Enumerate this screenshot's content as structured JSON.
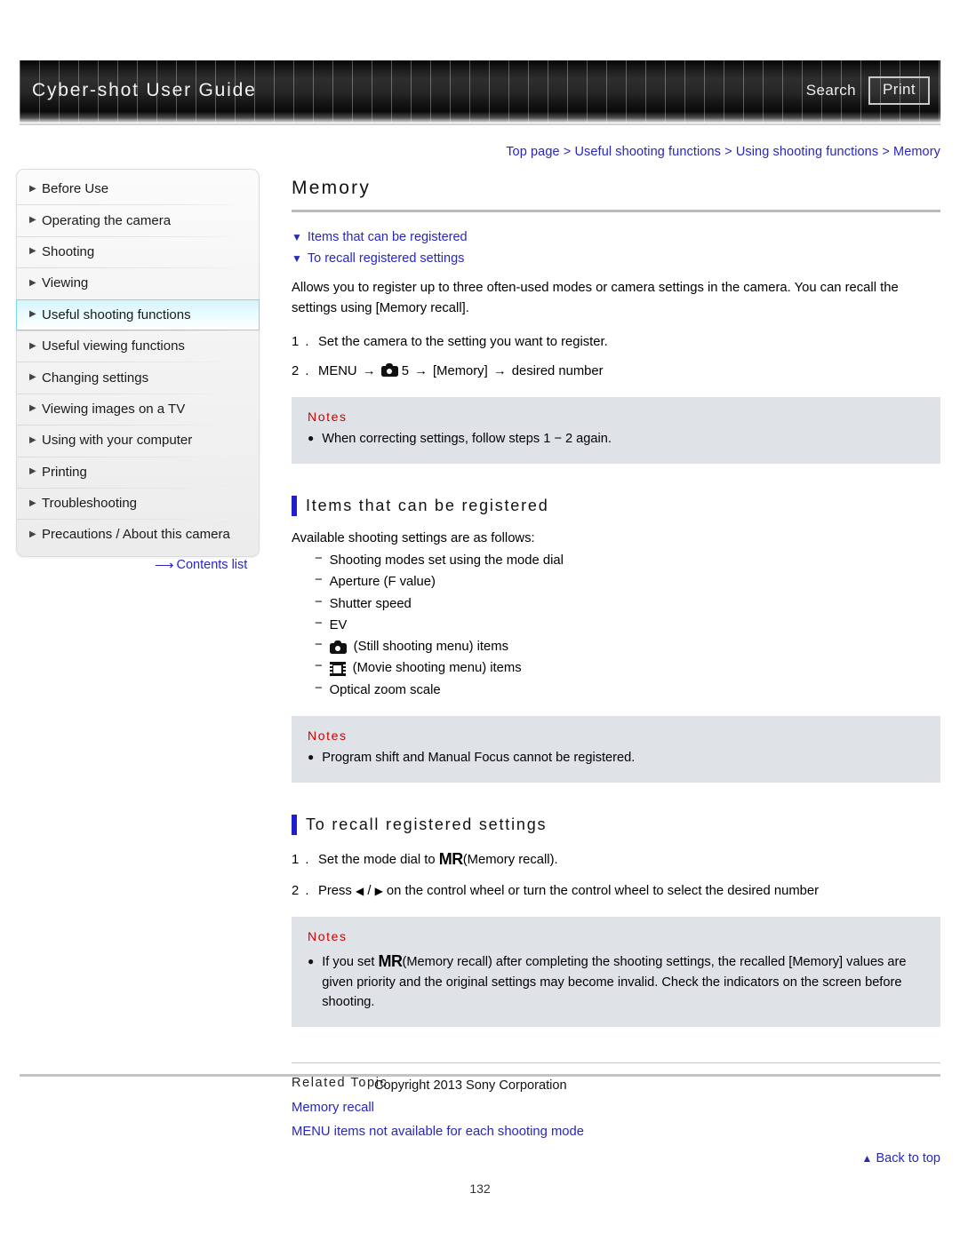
{
  "header": {
    "brand_title": "Cyber-shot User Guide",
    "search_label": "Search",
    "print_label": "Print"
  },
  "breadcrumb": {
    "text": "Top page > Useful shooting functions > Using shooting functions > Memory"
  },
  "sidebar": {
    "items": [
      {
        "label": "Before Use",
        "selected": false
      },
      {
        "label": "Operating the camera",
        "selected": false
      },
      {
        "label": "Shooting",
        "selected": false
      },
      {
        "label": "Viewing",
        "selected": false
      },
      {
        "label": "Useful shooting functions",
        "selected": true
      },
      {
        "label": "Useful viewing functions",
        "selected": false
      },
      {
        "label": "Changing settings",
        "selected": false
      },
      {
        "label": "Viewing images on a TV",
        "selected": false
      },
      {
        "label": "Using with your computer",
        "selected": false
      },
      {
        "label": "Printing",
        "selected": false
      },
      {
        "label": "Troubleshooting",
        "selected": false
      },
      {
        "label": "Precautions / About this camera",
        "selected": false
      }
    ],
    "contents_list_label": "Contents list"
  },
  "main": {
    "page_title": "Memory",
    "jump_links": [
      "Items that can be registered",
      "To recall registered settings"
    ],
    "lead_paragraph": "Allows you to register up to three often-used modes or camera settings in the camera. You can recall the settings using [Memory recall].",
    "steps": [
      {
        "num": "1 .",
        "text": "Set the camera to the setting you want to register."
      },
      {
        "num": "2 .",
        "text_before_icon": "MENU",
        "arrow": "→",
        "icon": "still-camera-icon",
        "text_after_icon": "5",
        "text_tail": "[Memory]",
        "text_end": "desired number"
      }
    ],
    "notes_1": {
      "title": "Notes",
      "items": [
        "When correcting settings, follow steps 1 − 2 again."
      ]
    },
    "section_registered": {
      "heading": "Items that can be registered",
      "intro": "Available shooting settings are as follows:",
      "list": [
        {
          "text": "Shooting modes set using the mode dial",
          "icon": null
        },
        {
          "text": "Aperture (F value)",
          "icon": null
        },
        {
          "text": "Shutter speed",
          "icon": null
        },
        {
          "text": "EV",
          "icon": null
        },
        {
          "text": "(Still shooting menu) items",
          "icon": "still-camera-icon"
        },
        {
          "text": "(Movie shooting menu) items",
          "icon": "movie-camera-icon"
        },
        {
          "text": "Optical zoom scale",
          "icon": null
        }
      ]
    },
    "notes_2": {
      "title": "Notes",
      "items": [
        "Program shift and Manual Focus cannot be registered."
      ]
    },
    "section_recall": {
      "heading": "To recall registered settings",
      "step1_num": "1 .",
      "step1_before": "Set the mode dial to",
      "step1_mark": "MR",
      "step1_after": "(Memory recall).",
      "step2_num": "2 .",
      "step2_before": "Press",
      "step2_left": "◀",
      "step2_slash": "/",
      "step2_right": "▶",
      "step2_after": "on the control wheel or turn the control wheel to select the desired number"
    },
    "notes_3": {
      "title": "Notes",
      "before_mark": "If you set",
      "mark": "MR",
      "after_mark": "(Memory recall) after completing the shooting settings, the recalled [Memory] values are given priority and the original settings may become invalid. Check the indicators on the screen before shooting."
    },
    "related": {
      "title": "Related Topic",
      "links": [
        "Memory recall",
        "MENU items not available for each shooting mode"
      ]
    },
    "back_to_top": "Back to top"
  },
  "footer": {
    "copyright": "Copyright 2013 Sony Corporation",
    "page_number": "132"
  },
  "colors": {
    "link": "#2727c0",
    "notes_title": "#cc0000",
    "section_bar": "#2020c8",
    "notes_bg": "#dfe2e7",
    "selected_nav": "#7fd8ea"
  }
}
